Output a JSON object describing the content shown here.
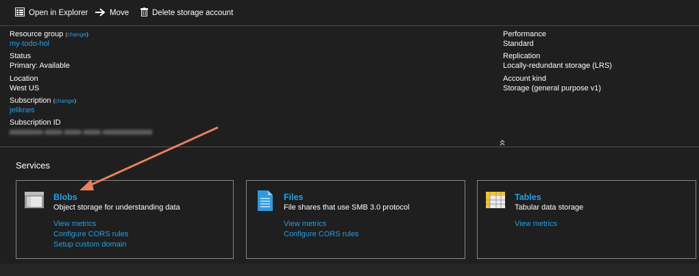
{
  "toolbar": {
    "open_label": "Open in Explorer",
    "move_label": "Move",
    "delete_label": "Delete storage account"
  },
  "essentials": {
    "resource_group": {
      "label": "Resource group",
      "change_open": "(",
      "change": "change",
      "change_close": ")",
      "value": "my-todo-hol"
    },
    "status": {
      "label": "Status",
      "value": "Primary: Available"
    },
    "location": {
      "label": "Location",
      "value": "West US"
    },
    "subscription": {
      "label": "Subscription",
      "change_open": "(",
      "change": "change",
      "change_close": ")",
      "value": "jeliknes"
    },
    "subscription_id": {
      "label": "Subscription ID",
      "value": "xxxxxxxx-xxxx-xxxx-xxxx-xxxxxxxxxxxx"
    },
    "performance": {
      "label": "Performance",
      "value": "Standard"
    },
    "replication": {
      "label": "Replication",
      "value": "Locally-redundant storage (LRS)"
    },
    "account_kind": {
      "label": "Account kind",
      "value": "Storage (general purpose v1)"
    }
  },
  "services": {
    "title": "Services",
    "cards": [
      {
        "name": "Blobs",
        "desc": "Object storage for understanding data",
        "icon": "blob-folder-icon",
        "links": [
          "View metrics",
          "Configure CORS rules",
          "Setup custom domain"
        ]
      },
      {
        "name": "Files",
        "desc": "File shares that use SMB 3.0 protocol",
        "icon": "file-document-icon",
        "links": [
          "View metrics",
          "Configure CORS rules"
        ]
      },
      {
        "name": "Tables",
        "desc": "Tabular data storage",
        "icon": "table-grid-icon",
        "links": [
          "View metrics"
        ]
      }
    ]
  },
  "colors": {
    "background": "#1f1f1f",
    "link": "#24a0e6",
    "annotation_arrow": "#e8825c"
  }
}
